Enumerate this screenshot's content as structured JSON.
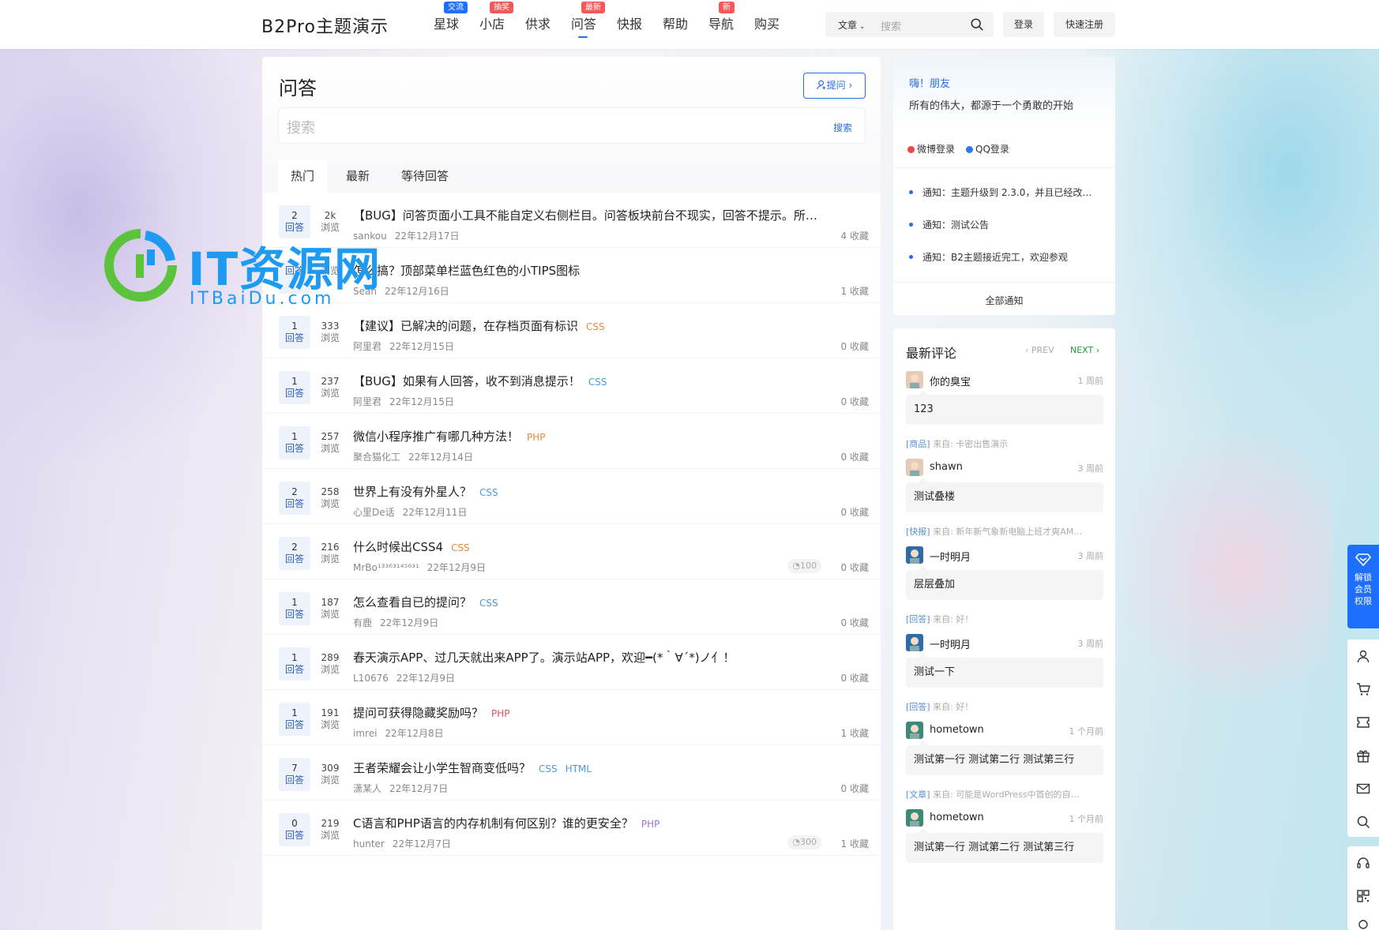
{
  "header": {
    "logo": "B2Pro主题演示",
    "nav": [
      {
        "label": "星球",
        "badge": "交流",
        "badge_color": "#1e6fff"
      },
      {
        "label": "小店",
        "badge": "抽奖",
        "badge_color": "#f25a5a"
      },
      {
        "label": "供求",
        "badge": "",
        "badge_color": ""
      },
      {
        "label": "问答",
        "badge": "最新",
        "badge_color": "#f25a5a",
        "active": true
      },
      {
        "label": "快报",
        "badge": "",
        "badge_color": ""
      },
      {
        "label": "帮助",
        "badge": "",
        "badge_color": ""
      },
      {
        "label": "导航",
        "badge": "新",
        "badge_color": "#f25a5a"
      },
      {
        "label": "购买",
        "badge": "",
        "badge_color": ""
      }
    ],
    "search_type": "文章",
    "search_placeholder": "搜索",
    "login": "登录",
    "register": "快速注册"
  },
  "main": {
    "title": "问答",
    "ask_button": "提问",
    "search_placeholder": "搜索",
    "search_button": "搜索",
    "tabs": [
      "热门",
      "最新",
      "等待回答"
    ],
    "answers_label": "回答",
    "views_label": "浏览",
    "fav_suffix": "收藏",
    "questions": [
      {
        "answers": "2",
        "views": "2k",
        "title": "【BUG】问答页面小工具不能自定义右侧栏目。问答板块前台不现实，回答不提示。所…",
        "tags": [],
        "author": "sankou",
        "date": "22年12月17日",
        "favs": "4",
        "reward": ""
      },
      {
        "answers": "",
        "views": "",
        "title": "怎么搞？顶部菜单栏蓝色红色的小TIPS图标",
        "tags": [],
        "author": "Sean",
        "date": "22年12月16日",
        "favs": "1",
        "reward": ""
      },
      {
        "answers": "1",
        "views": "333",
        "title": "【建议】已解决的问题，在存档页面有标识",
        "tags": [
          {
            "t": "CSS",
            "c": "#e08c3c"
          }
        ],
        "author": "阿里君",
        "date": "22年12月15日",
        "favs": "0",
        "reward": ""
      },
      {
        "answers": "1",
        "views": "237",
        "title": "【BUG】如果有人回答，收不到消息提示！",
        "tags": [
          {
            "t": "CSS",
            "c": "#4a9bd8"
          }
        ],
        "author": "阿里君",
        "date": "22年12月15日",
        "favs": "0",
        "reward": ""
      },
      {
        "answers": "1",
        "views": "257",
        "title": "微信小程序推广有哪几种方法！",
        "tags": [
          {
            "t": "PHP",
            "c": "#e08c3c"
          }
        ],
        "author": "聚合猫化工",
        "date": "22年12月14日",
        "favs": "0",
        "reward": ""
      },
      {
        "answers": "2",
        "views": "258",
        "title": "世界上有没有外星人？",
        "tags": [
          {
            "t": "CSS",
            "c": "#4a9bd8"
          }
        ],
        "author": "心里De话",
        "date": "22年12月11日",
        "favs": "0",
        "reward": ""
      },
      {
        "answers": "2",
        "views": "216",
        "title": "什么时候出CSS4",
        "tags": [
          {
            "t": "CSS",
            "c": "#e08c3c"
          }
        ],
        "author": "MrBo¹³³⁶³¹⁴⁵⁶³¹",
        "date": "22年12月9日",
        "favs": "0",
        "reward": "100"
      },
      {
        "answers": "1",
        "views": "187",
        "title": "怎么查看自已的提问？",
        "tags": [
          {
            "t": "CSS",
            "c": "#4a9bd8"
          }
        ],
        "author": "有鹿",
        "date": "22年12月9日",
        "favs": "0",
        "reward": ""
      },
      {
        "answers": "1",
        "views": "289",
        "title": "春天演示APP、过几天就出来APP了。演示站APP，欢迎━(*｀∀´*)ノ亻！",
        "tags": [],
        "author": "L10676",
        "date": "22年12月9日",
        "favs": "0",
        "reward": ""
      },
      {
        "answers": "1",
        "views": "191",
        "title": "提问可获得隐藏奖励吗？",
        "tags": [
          {
            "t": "PHP",
            "c": "#d8545a"
          }
        ],
        "author": "imrei",
        "date": "22年12月8日",
        "favs": "1",
        "reward": ""
      },
      {
        "answers": "7",
        "views": "309",
        "title": "王者荣耀会让小学生智商变低吗？",
        "tags": [
          {
            "t": "CSS",
            "c": "#4a9bd8"
          },
          {
            "t": "HTML",
            "c": "#4a9bd8"
          }
        ],
        "author": "潇某人",
        "date": "22年12月7日",
        "favs": "0",
        "reward": ""
      },
      {
        "answers": "0",
        "views": "219",
        "title": "C语言和PHP语言的内存机制有何区别？谁的更安全？",
        "tags": [
          {
            "t": "PHP",
            "c": "#a070d0"
          }
        ],
        "author": "hunter",
        "date": "22年12月7日",
        "favs": "1",
        "reward": "300"
      }
    ]
  },
  "sidebar": {
    "greeting": "嗨！朋友",
    "motto": "所有的伟大，都源于一个勇敢的开始",
    "weibo_login": "微博登录",
    "qq_login": "QQ登录",
    "notices": [
      "通知：主题升级到 2.3.0，并且已经改…",
      "通知：测试公告",
      "通知：B2主题接近完工，欢迎参观"
    ],
    "all_notices": "全部通知",
    "comments_title": "最新评论",
    "prev": "PREV",
    "next": "NEXT",
    "from_label": "来自:",
    "comments": [
      {
        "user": "你的臭宝",
        "time": "1 周前",
        "text": "123",
        "kind": "[商品]",
        "source": "卡密出售演示"
      },
      {
        "user": "shawn",
        "time": "3 周前",
        "text": "测试叠楼",
        "kind": "[快报]",
        "source": "新年新气象新电脑上班才爽AM…"
      },
      {
        "user": "一时明月",
        "time": "3 周前",
        "text": "层层叠加",
        "kind": "[回答]",
        "source": "好！"
      },
      {
        "user": "一时明月",
        "time": "3 周前",
        "text": "测试一下",
        "kind": "[回答]",
        "source": "好！"
      },
      {
        "user": "hometown",
        "time": "1 个月前",
        "text": "测试第一行 测试第二行 测试第三行",
        "kind": "[文章]",
        "source": "可能是WordPress中首创的自…"
      },
      {
        "user": "hometown",
        "time": "1 个月前",
        "text": "测试第一行 测试第二行 测试第三行",
        "kind": "",
        "source": ""
      }
    ]
  },
  "floating": {
    "unlock": [
      "解锁",
      "会员",
      "权限"
    ]
  },
  "watermark": {
    "big": "IT资源网",
    "small": "ITBaiDu.com"
  },
  "colors": {
    "accent": "#1e6fff",
    "badge_red": "#f25a5a",
    "next_green": "#1c9b3c"
  }
}
